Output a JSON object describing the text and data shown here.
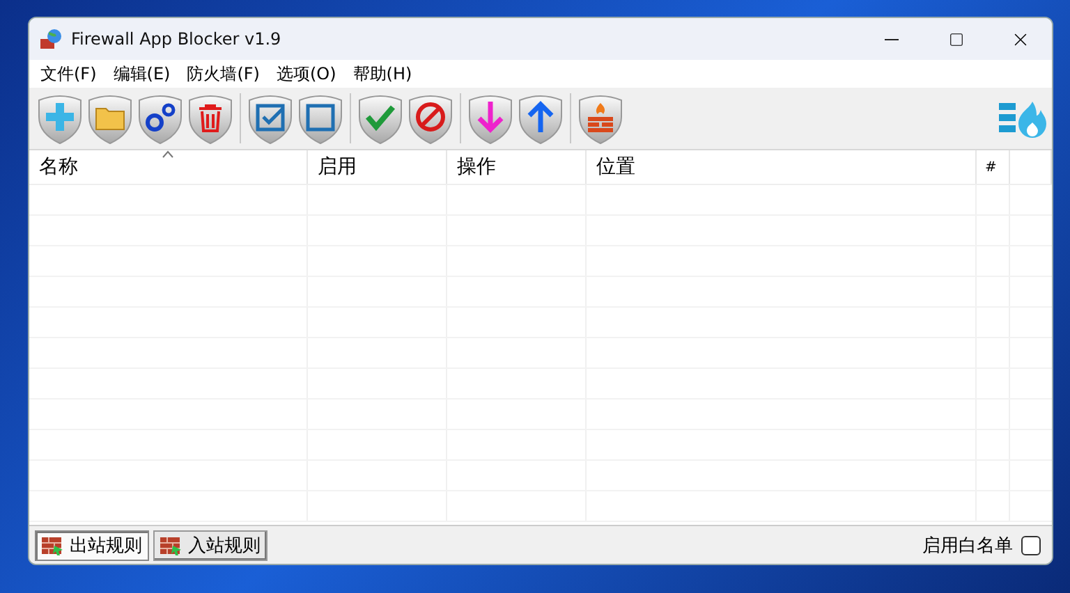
{
  "window": {
    "title": "Firewall App Blocker v1.9"
  },
  "menu": [
    "文件(F)",
    "编辑(E)",
    "防火墙(F)",
    "选项(O)",
    "帮助(H)"
  ],
  "toolbar": [
    {
      "kind": "add"
    },
    {
      "kind": "folder"
    },
    {
      "kind": "gears"
    },
    {
      "kind": "trash"
    },
    {
      "kind": "sep"
    },
    {
      "kind": "checkbox"
    },
    {
      "kind": "box"
    },
    {
      "kind": "sep"
    },
    {
      "kind": "check"
    },
    {
      "kind": "block"
    },
    {
      "kind": "sep"
    },
    {
      "kind": "down"
    },
    {
      "kind": "up"
    },
    {
      "kind": "sep"
    },
    {
      "kind": "firewall"
    }
  ],
  "table": {
    "columns": [
      {
        "label": "名称",
        "sorted": true
      },
      {
        "label": "启用",
        "sorted": false
      },
      {
        "label": "操作",
        "sorted": false
      },
      {
        "label": "位置",
        "sorted": false
      },
      {
        "label": "#",
        "sorted": false
      }
    ]
  },
  "tabs": [
    {
      "label": "出站规则",
      "selected": true
    },
    {
      "label": "入站规则",
      "selected": false
    }
  ],
  "whitelist": {
    "label": "启用白名单",
    "checked": false
  }
}
